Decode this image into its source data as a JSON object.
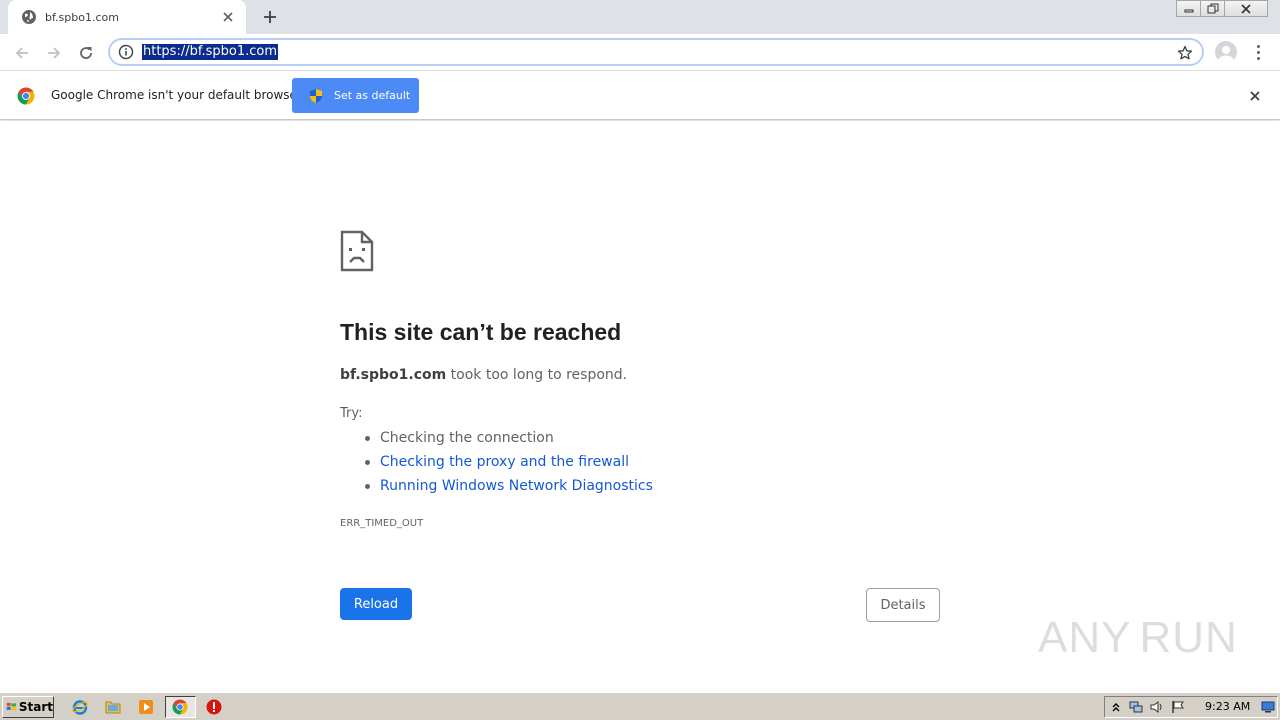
{
  "tab": {
    "title": "bf.spbo1.com"
  },
  "toolbar": {
    "url": "https://bf.spbo1.com"
  },
  "infobar": {
    "message": "Google Chrome isn't your default browser",
    "button_label": "Set as default"
  },
  "error": {
    "title": "This site can’t be reached",
    "host": "bf.spbo1.com",
    "description": " took too long to respond.",
    "try_label": "Try:",
    "suggestions": [
      {
        "text": "Checking the connection",
        "is_link": false
      },
      {
        "text": "Checking the proxy and the firewall",
        "is_link": true
      },
      {
        "text": "Running Windows Network Diagnostics",
        "is_link": true
      }
    ],
    "code": "ERR_TIMED_OUT",
    "reload_label": "Reload",
    "details_label": "Details"
  },
  "watermark": {
    "left": "ANY",
    "right": "RUN"
  },
  "taskbar": {
    "start_label": "Start",
    "clock": "9:23 AM"
  },
  "colors": {
    "accent": "#1a73e8",
    "infobar_button": "#4c8bf5",
    "link": "#1558d6",
    "selection": "#0b2b8f"
  },
  "icons": [
    "globe-icon",
    "close-icon",
    "plus-icon",
    "back-arrow-icon",
    "forward-arrow-icon",
    "reload-icon",
    "info-icon",
    "star-icon",
    "avatar-icon",
    "menu-icon",
    "chrome-logo-icon",
    "shield-icon",
    "sad-page-icon",
    "windows-flag-icon",
    "internet-explorer-icon",
    "folder-icon",
    "media-player-icon",
    "chrome-icon",
    "stop-icon",
    "chevron-up-icon",
    "network-icon",
    "volume-icon",
    "flag-icon",
    "desktop-icon"
  ]
}
